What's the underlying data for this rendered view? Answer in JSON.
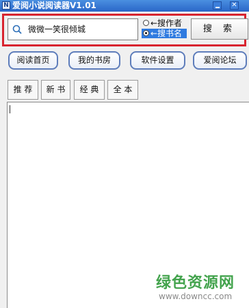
{
  "window": {
    "title": "爱阅小说阅读器V1.01",
    "close_glyph": "✕"
  },
  "search": {
    "query": "微微一笑很倾城",
    "button_label": "搜 索"
  },
  "search_mode": {
    "options": [
      {
        "label": "←搜作者",
        "checked": false
      },
      {
        "label": "←搜书名",
        "checked": true
      }
    ]
  },
  "nav": {
    "items": [
      {
        "label": "阅读首页"
      },
      {
        "label": "我的书房"
      },
      {
        "label": "软件设置"
      },
      {
        "label": "爱阅论坛"
      }
    ]
  },
  "categories": {
    "items": [
      {
        "label": "推 荐"
      },
      {
        "label": "新 书"
      },
      {
        "label": "经 典"
      },
      {
        "label": "全 本"
      }
    ]
  },
  "watermark": {
    "text": "绿色资源网",
    "url": "www.downcc.com"
  },
  "colors": {
    "titlebar": "#2a66c8",
    "highlight_border": "#d8242f",
    "selected_radio": "#2f7be0",
    "nav_border": "#5e7dbb",
    "watermark": "#2f9a3a"
  }
}
